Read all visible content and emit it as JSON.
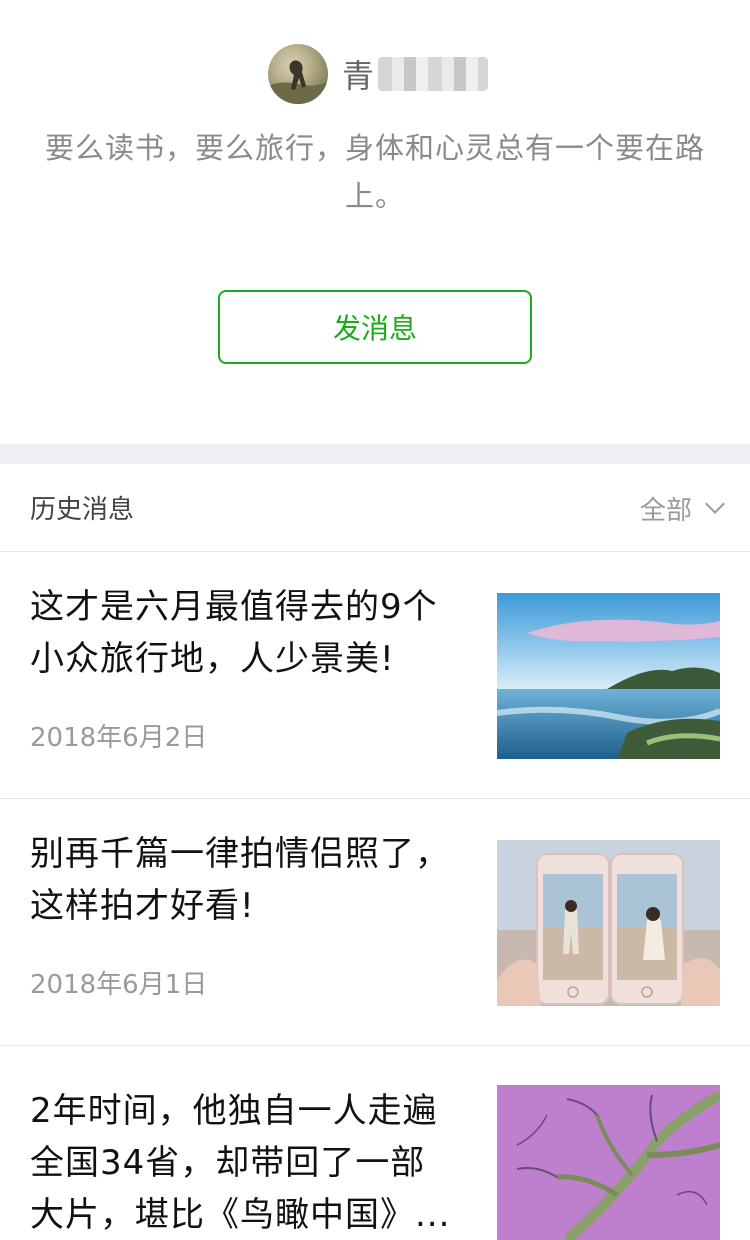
{
  "profile": {
    "name_visible": "青",
    "bio": "要么读书，要么旅行，身体和心灵总有一个要在路上。",
    "message_button": "发消息"
  },
  "history": {
    "title": "历史消息",
    "filter_label": "全部",
    "filter_icon": "chevron-down-icon"
  },
  "articles": [
    {
      "title": "这才是六月最值得去的9个小众旅行地，人少景美!",
      "date": "2018年6月2日",
      "thumb": "coastline-sunset-photo"
    },
    {
      "title": "别再千篇一律拍情侣照了，这样拍才好看!",
      "date": "2018年6月1日",
      "thumb": "couple-phones-photo"
    },
    {
      "title": "2年时间，他独自一人走遍全国34省，却带回了一部大片，堪比《鸟瞰中国》...",
      "date": "",
      "thumb": "aerial-river-delta-photo"
    }
  ],
  "colors": {
    "accent_green": "#1aad19",
    "separator_band": "#efeff4",
    "muted_text": "#9a9a9a"
  }
}
